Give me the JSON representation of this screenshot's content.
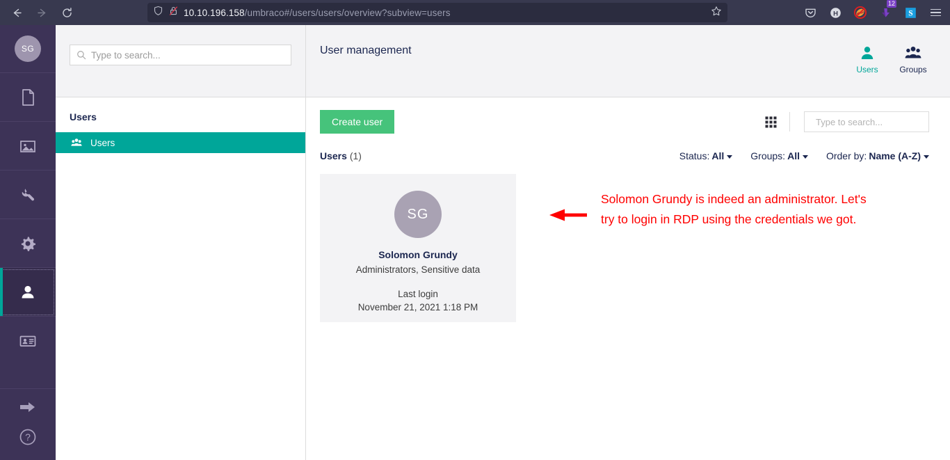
{
  "browser": {
    "back_label": "Back",
    "forward_label": "Forward",
    "reload_label": "Reload",
    "url_host": "10.10.196.158",
    "url_path": "/umbraco#/users/users/overview?subview=users",
    "bookmark_label": "Bookmark this page",
    "shield_label": "Tracking protection",
    "lock_label": "Connection is not secure",
    "extensions": [
      {
        "name": "pocket-icon",
        "label": "Pocket"
      },
      {
        "name": "h-circle-icon",
        "label": "H"
      },
      {
        "name": "blocker-icon",
        "label": "Blocker"
      },
      {
        "name": "downloads-icon",
        "label": "Downloads",
        "badge": "12"
      },
      {
        "name": "s-app-icon",
        "label": "S"
      }
    ],
    "menu_label": "Open application menu"
  },
  "rail": {
    "avatar_initials": "SG",
    "items": [
      {
        "name": "content-icon",
        "label": "Content",
        "active": false
      },
      {
        "name": "media-icon",
        "label": "Media",
        "active": false
      },
      {
        "name": "settings-wrench-icon",
        "label": "Settings",
        "active": false
      },
      {
        "name": "gear-icon",
        "label": "Developer",
        "active": false
      },
      {
        "name": "users-icon",
        "label": "Users",
        "active": true
      },
      {
        "name": "members-icon",
        "label": "Members",
        "active": false
      }
    ],
    "bottom": [
      {
        "name": "arrow-right-icon",
        "label": "Toggle navigation"
      },
      {
        "name": "help-icon",
        "label": "Help"
      }
    ]
  },
  "tree": {
    "search": {
      "placeholder": "Type to search...",
      "value": ""
    },
    "heading": "Users",
    "items": [
      {
        "label": "Users",
        "icon": "users-group-icon",
        "active": true
      }
    ]
  },
  "main": {
    "title": "User management",
    "tabs": [
      {
        "label": "Users",
        "icon": "user-icon",
        "active": true
      },
      {
        "label": "Groups",
        "icon": "group-icon",
        "active": false
      }
    ],
    "create_button": "Create user",
    "grid_toggle_label": "Toggle grid view",
    "search": {
      "placeholder": "Type to search...",
      "value": ""
    },
    "users_count_label": "Users",
    "users_count_value": "(1)",
    "filters": [
      {
        "label": "Status:",
        "value": "All"
      },
      {
        "label": "Groups:",
        "value": "All"
      },
      {
        "label": "Order by:",
        "value": "Name (A-Z)"
      }
    ]
  },
  "user_card": {
    "initials": "SG",
    "name": "Solomon Grundy",
    "groups": "Administrators, Sensitive data",
    "last_login_label": "Last login",
    "last_login_value": "November 21, 2021 1:18 PM"
  },
  "annotation": {
    "text": "Solomon Grundy is indeed an administrator. Let's try to login in RDP using the credentials we got.",
    "color": "#ff0000",
    "arrow": "left-arrow"
  },
  "colors": {
    "accent_teal": "#00a699",
    "create_green": "#46c37b",
    "rail_purple": "#3d3357",
    "chrome_dark": "#38394f",
    "annotation_red": "#ff0000"
  }
}
